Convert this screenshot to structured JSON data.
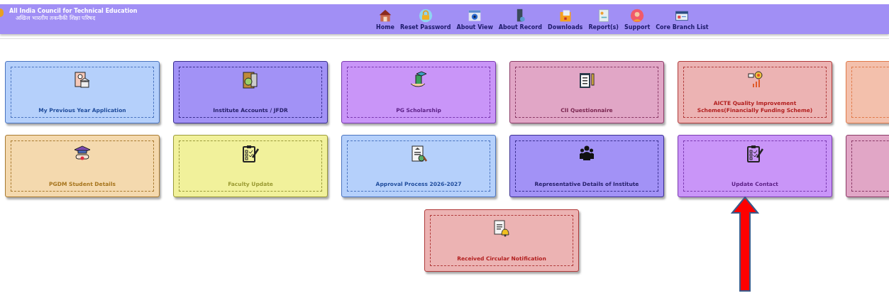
{
  "header": {
    "title_en": "All India Council for Technical Education",
    "title_hi": "अखिल भारतीय तकनीकी शिक्षा परिषद",
    "nav": [
      {
        "label": "Home"
      },
      {
        "label": "Reset Password"
      },
      {
        "label": "About View"
      },
      {
        "label": "About Record"
      },
      {
        "label": "Downloads"
      },
      {
        "label": "Report(s)"
      },
      {
        "label": "Support"
      },
      {
        "label": "Core Branch List"
      }
    ]
  },
  "rows": [
    {
      "cards": [
        {
          "label": "My Previous Year Application",
          "kind": "blue"
        },
        {
          "label": "Institute Accounts / JFDR",
          "kind": "indigo"
        },
        {
          "label": "PG Scholarship",
          "kind": "violet"
        },
        {
          "label": "CII Questionnaire",
          "kind": "pink"
        },
        {
          "label": "AICTE Quality Improvement Schemes(Financially Funding Scheme)",
          "kind": "rose"
        },
        {
          "kind": "peach"
        }
      ]
    },
    {
      "cards": [
        {
          "label": "PGDM Student Details",
          "kind": "tan"
        },
        {
          "label": "Faculty Update",
          "kind": "yellow"
        },
        {
          "label": "Approval Process 2026-2027",
          "kind": "blue"
        },
        {
          "label": "Representative Details of Institute",
          "kind": "indigo"
        },
        {
          "label": "Update Contact",
          "kind": "violet"
        },
        {
          "kind": "pink"
        }
      ]
    },
    {
      "cards": [
        {
          "label": "Received Circular Notification",
          "kind": "rose"
        }
      ]
    }
  ],
  "annotation": {
    "kind": "arrow"
  }
}
